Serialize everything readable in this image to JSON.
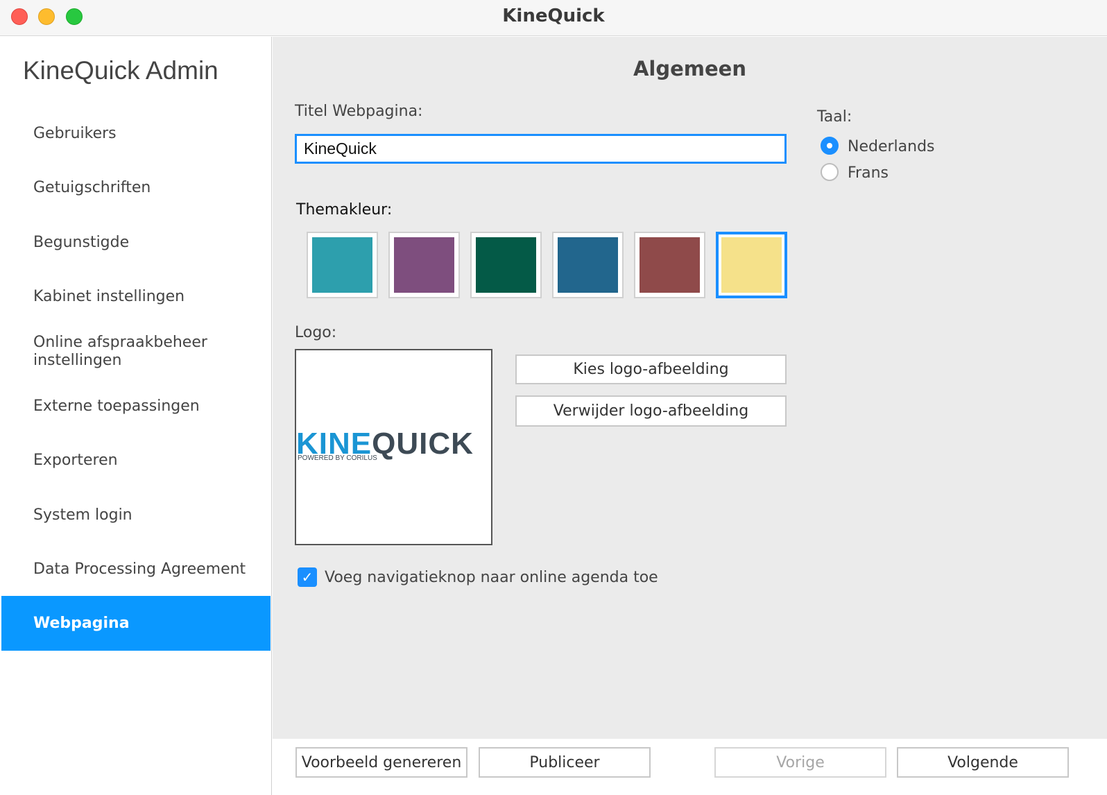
{
  "window": {
    "title": "KineQuick"
  },
  "sidebar": {
    "title": "KineQuick Admin",
    "items": [
      {
        "label": "Gebruikers"
      },
      {
        "label": "Getuigschriften"
      },
      {
        "label": "Begunstigde"
      },
      {
        "label": "Kabinet instellingen"
      },
      {
        "label": "Online afspraakbeheer instellingen"
      },
      {
        "label": "Externe toepassingen"
      },
      {
        "label": "Exporteren"
      },
      {
        "label": "System login"
      },
      {
        "label": "Data Processing Agreement"
      },
      {
        "label": "Webpagina"
      }
    ],
    "active_item": "Webpagina"
  },
  "main": {
    "title": "Algemeen",
    "page_title_label": "Titel Webpagina:",
    "page_title_value": "KineQuick",
    "theme_label": "Themakleur:",
    "theme_colors": [
      "#2d9fad",
      "#7e4e7e",
      "#045a47",
      "#22668d",
      "#8f4a4a",
      "#f5e18a"
    ],
    "selected_color": "#f5e18a",
    "language_label": "Taal:",
    "languages": [
      {
        "label": "Nederlands",
        "checked": true
      },
      {
        "label": "Frans",
        "checked": false
      }
    ],
    "logo_label": "Logo:",
    "logo": {
      "word1": "KINE",
      "word2": "QUICK",
      "subtitle": "POWERED BY CORILUS"
    },
    "choose_logo_button": "Kies logo-afbeelding",
    "remove_logo_button": "Verwijder logo-afbeelding",
    "nav_checkbox_label": "Voeg navigatieknop naar online agenda toe",
    "nav_checkbox_checked": true
  },
  "footer": {
    "preview_button": "Voorbeeld genereren",
    "publish_button": "Publiceer",
    "previous_button": "Vorige",
    "next_button": "Volgende"
  },
  "colors": {
    "accent": "#0a98ff",
    "focus": "#1a8fff"
  }
}
